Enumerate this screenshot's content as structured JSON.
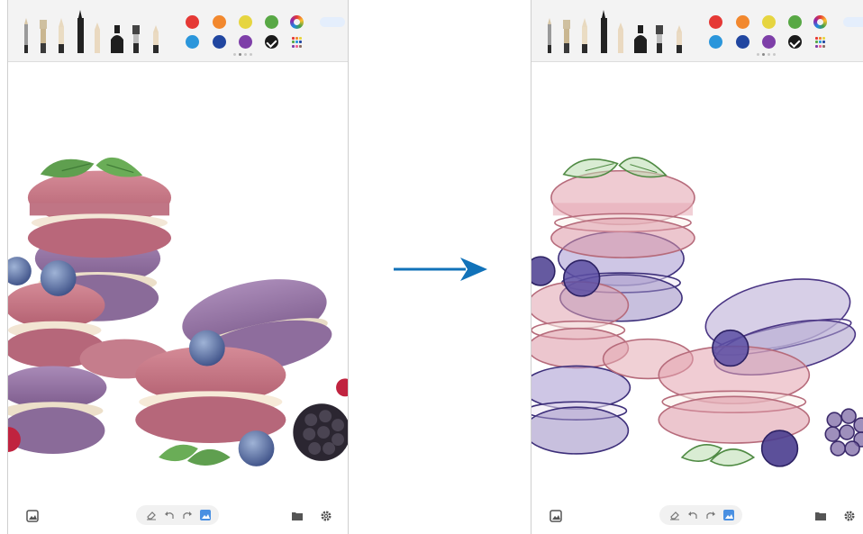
{
  "colors": {
    "accent": "#1172b9",
    "toolbar_bg": "#f3f3f3",
    "palette": [
      "#e53935",
      "#f2882e",
      "#e6d540",
      "#58a845",
      "#2b96db",
      "#2146a0",
      "#7e3fa8",
      "#1a1a1a"
    ],
    "grid_dots": [
      "#e53935",
      "#f2882e",
      "#e6d540",
      "#58a845",
      "#2b96db",
      "#2146a0",
      "#7e3fa8",
      "#f06292",
      "#8d6e63"
    ]
  },
  "left_panel": {
    "state": "original photo of stacked macarons with blueberries, mint and a blackberry",
    "icons": {
      "pens": [
        "pencil-icon",
        "marker-icon",
        "brush-icon",
        "fountain-pen-icon",
        "colored-pencil-icon",
        "ink-bottle-icon",
        "highlighter-icon",
        "eraser-pen-icon"
      ],
      "palette_more": "color-wheel-icon",
      "palette_grid": "color-grid-icon",
      "done": "done-button",
      "image": "insert-image-icon",
      "eraser": "eraser-icon",
      "undo": "undo-icon",
      "redo": "redo-icon",
      "gallery": "image-background-icon",
      "folder": "folder-icon",
      "settings": "settings-icon"
    },
    "selected_color_index": 7
  },
  "right_panel": {
    "state": "same image redrawn as a watercolor sketch",
    "selected_color_index": 7
  },
  "arrow": {
    "icon": "arrow-right-icon"
  },
  "toolbar": {
    "done_label": ""
  }
}
